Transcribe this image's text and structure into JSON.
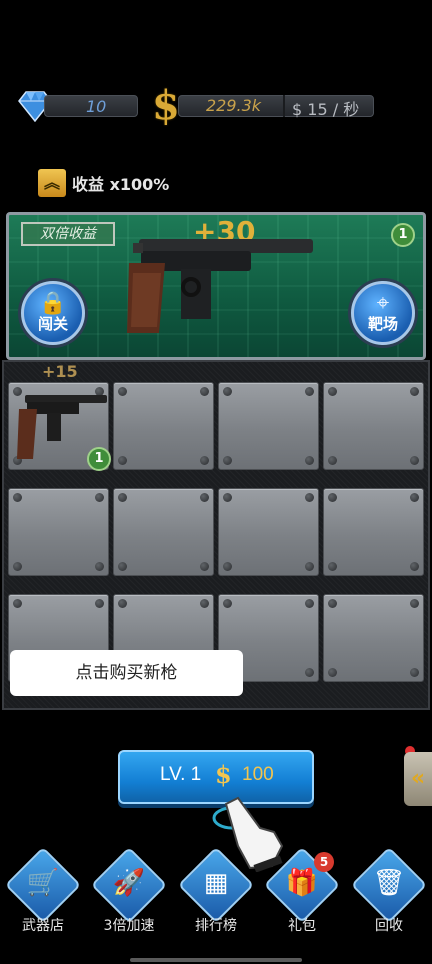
{
  "currency": {
    "gems": "10",
    "cash": "229.3k",
    "rate_symbol": "$",
    "rate_value": "15",
    "rate_unit": "/ 秒"
  },
  "income": {
    "label": "收益 x100%"
  },
  "feature": {
    "double_tag": "双倍收益",
    "plus_value": "+30",
    "level": "1",
    "left_button": "闯关",
    "right_button": "靶场"
  },
  "grid": {
    "plus_value": "+15",
    "first_gun_level": "1"
  },
  "hint": {
    "text": "点击购买新枪"
  },
  "buy": {
    "level": "LV. 1",
    "symbol": "$",
    "cost": "100"
  },
  "side_tab": {
    "glyph": "«"
  },
  "nav": {
    "items": [
      {
        "label": "武器店",
        "glyph": "🛒"
      },
      {
        "label": "3倍加速",
        "glyph": "🚀"
      },
      {
        "label": "排行榜",
        "glyph": "▦"
      },
      {
        "label": "礼包",
        "glyph": "🎁",
        "badge": "5"
      },
      {
        "label": "回收",
        "glyph": "🗑"
      }
    ]
  },
  "colors": {
    "panel_green": "#1e7b57",
    "button_blue": "#137fd4",
    "gold": "#e0b13a"
  }
}
